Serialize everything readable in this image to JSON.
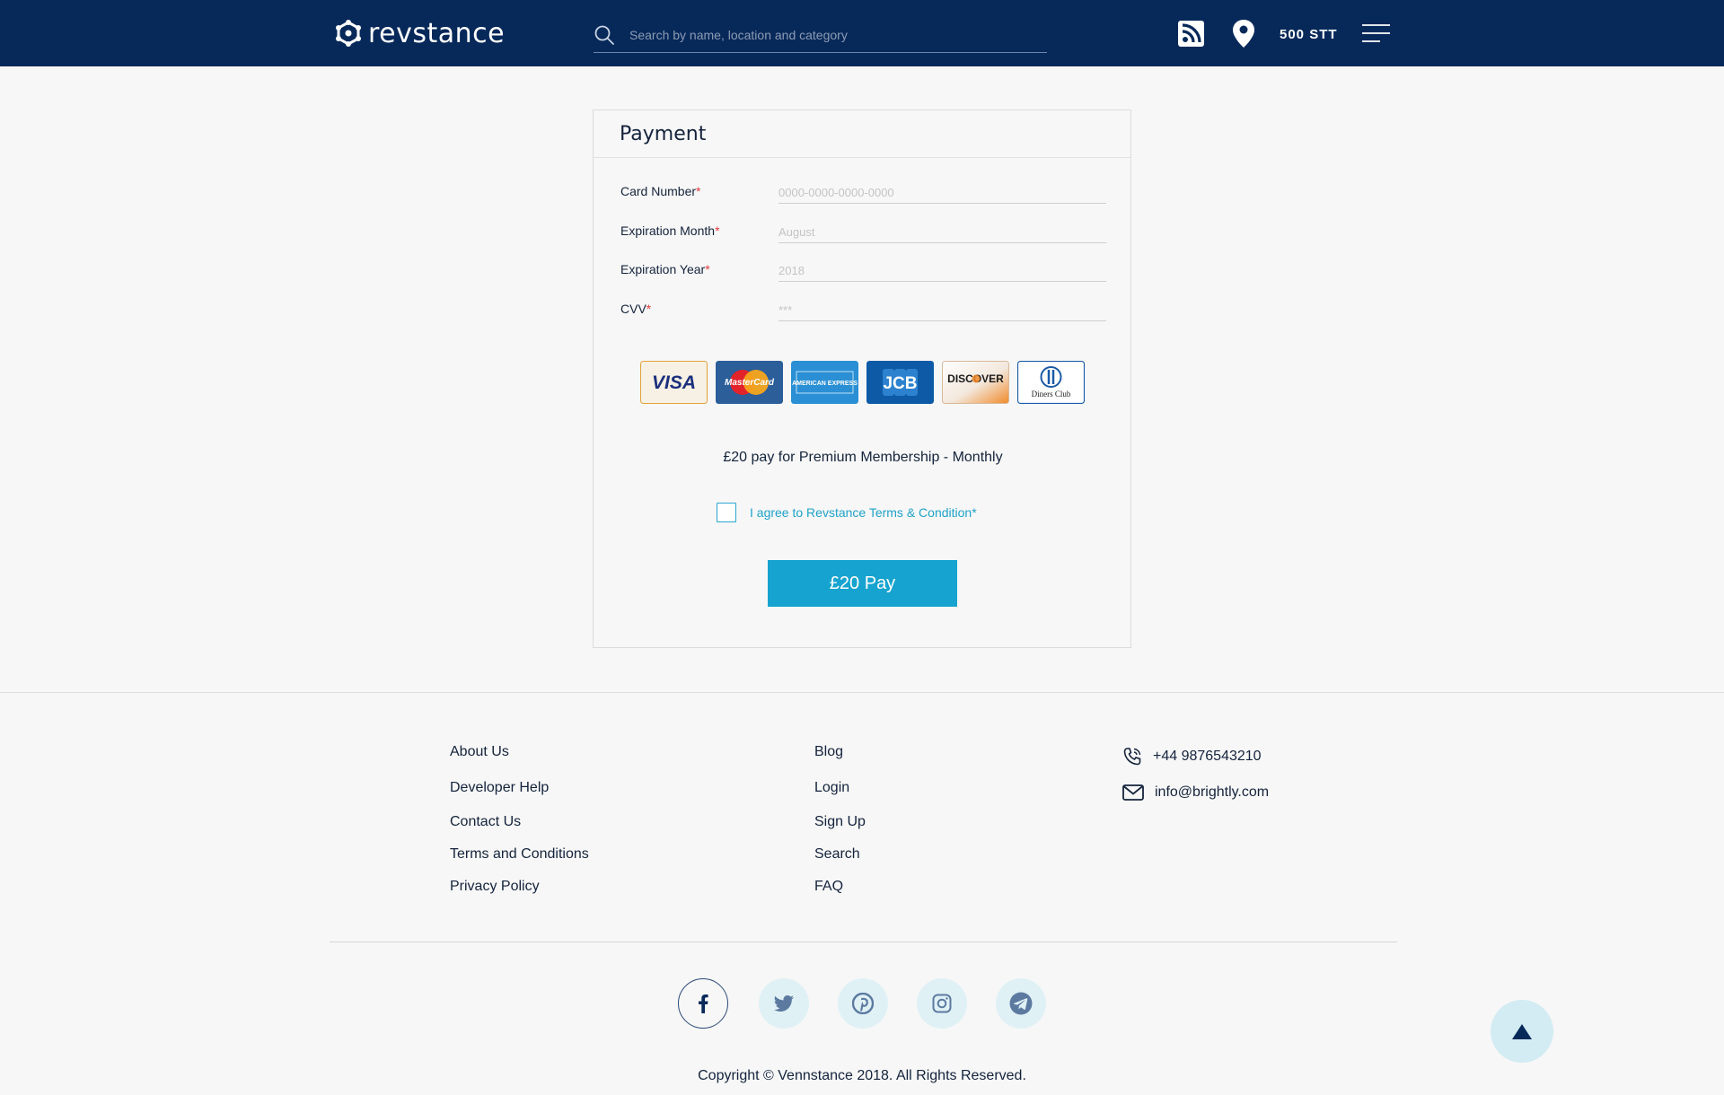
{
  "header": {
    "logo_text": "revstance",
    "search_placeholder": "Search by name, location and category",
    "balance": "500 STT",
    "icons": [
      "rss-icon",
      "location-pin-icon",
      "menu-icon",
      "search-icon"
    ]
  },
  "payment": {
    "title": "Payment",
    "fields": [
      {
        "label": "Card Number",
        "required": "*",
        "placeholder": "0000-0000-0000-0000",
        "value": ""
      },
      {
        "label": "Expiration Month",
        "required": "*",
        "placeholder": "August",
        "value": ""
      },
      {
        "label": "Expiration Year",
        "required": "*",
        "placeholder": "2018",
        "value": ""
      },
      {
        "label": "CVV",
        "required": "*",
        "placeholder": "***",
        "value": ""
      }
    ],
    "card_brands": [
      "VISA",
      "MasterCard",
      "AMERICAN EXPRESS",
      "JCB",
      "DISCOVER",
      "Diners Club"
    ],
    "membership_text": "£20 pay for Premium Membership - Monthly",
    "agree_text": "I agree to Revstance Terms & Condition*",
    "agree_checked": false,
    "pay_button": "£20 Pay"
  },
  "footer": {
    "col1": [
      "About Us",
      "Developer Help",
      "Contact Us",
      "Terms and Conditions",
      "Privacy Policy"
    ],
    "col2": [
      "Blog",
      "Login",
      "Sign Up",
      "Search",
      "FAQ"
    ],
    "phone": "+44 9876543210",
    "email": "info@brightly.com",
    "social": [
      "facebook-icon",
      "twitter-icon",
      "pinterest-icon",
      "instagram-icon",
      "telegram-icon"
    ],
    "copyright": "Copyright © Vennstance 2018. All Rights Reserved."
  },
  "colors": {
    "header_bg": "#07295a",
    "accent": "#17a3cf",
    "required": "#e0393e",
    "text": "#14233c"
  }
}
